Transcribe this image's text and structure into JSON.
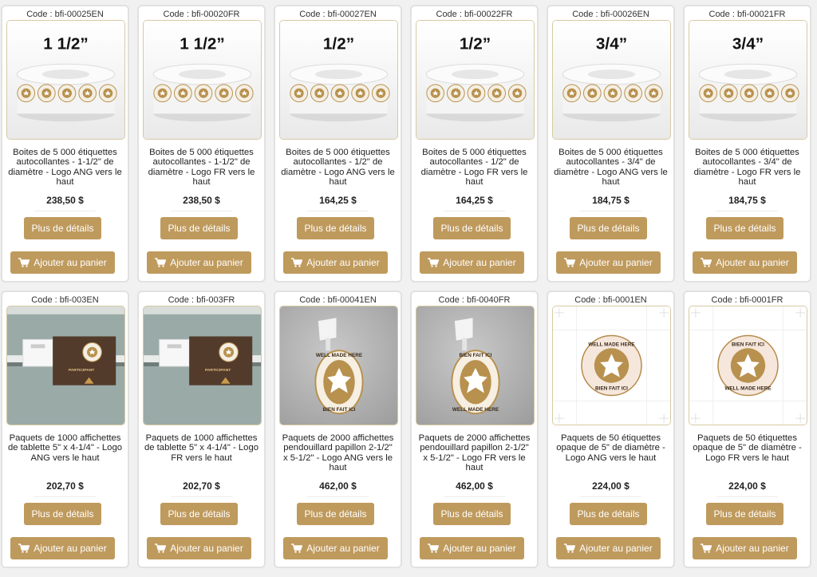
{
  "colors": {
    "accent": "#bf9a5d",
    "border": "#e1e1e1",
    "image_border": "#d8c9a3"
  },
  "products": [
    {
      "code": "Code : bfi-00025EN",
      "title": "Boites de 5 000 étiquettes autocollantes - 1-1/2\" de diamètre - Logo ANG vers le haut",
      "price": "238,50 $",
      "details_label": "Plus de détails",
      "cart_label": "Ajouter au panier",
      "image": {
        "kind": "roll",
        "size_label": "1 1/2”",
        "seal_text": "WELL MADE HERE"
      }
    },
    {
      "code": "Code : bfi-00020FR",
      "title": "Boites de 5 000 étiquettes autocollantes - 1-1/2\" de diamètre - Logo FR vers le haut",
      "price": "238,50 $",
      "details_label": "Plus de détails",
      "cart_label": "Ajouter au panier",
      "image": {
        "kind": "roll",
        "size_label": "1 1/2”",
        "seal_text": "BIEN FAIT ICI"
      }
    },
    {
      "code": "Code : bfi-00027EN",
      "title": "Boites de 5 000 étiquettes autocollantes - 1/2\" de diamètre - Logo ANG vers le haut",
      "price": "164,25 $",
      "details_label": "Plus de détails",
      "cart_label": "Ajouter au panier",
      "image": {
        "kind": "roll",
        "size_label": "1/2”",
        "seal_text": "WELL MADE HERE"
      }
    },
    {
      "code": "Code : bfi-00022FR",
      "title": "Boites de 5 000 étiquettes autocollantes - 1/2\" de diamètre - Logo FR vers le haut",
      "price": "164,25 $",
      "details_label": "Plus de détails",
      "cart_label": "Ajouter au panier",
      "image": {
        "kind": "roll",
        "size_label": "1/2”",
        "seal_text": "BIEN FAIT ICI"
      }
    },
    {
      "code": "Code : bfi-00026EN",
      "title": "Boites de 5 000 étiquettes autocollantes - 3/4\" de diamètre - Logo ANG vers le haut",
      "price": "184,75 $",
      "details_label": "Plus de détails",
      "cart_label": "Ajouter au panier",
      "image": {
        "kind": "roll",
        "size_label": "3/4”",
        "seal_text": "WELL MADE HERE"
      }
    },
    {
      "code": "Code : bfi-00021FR",
      "title": "Boites de 5 000 étiquettes autocollantes - 3/4\" de diamètre - Logo FR vers le haut",
      "price": "184,75 $",
      "details_label": "Plus de détails",
      "cart_label": "Ajouter au panier",
      "image": {
        "kind": "roll",
        "size_label": "3/4”",
        "seal_text": "BIEN FAIT ICI"
      }
    },
    {
      "code": "Code : bfi-003EN",
      "title": "Paquets de 1000 affichettes de tablette 5\" x 4-1/4\" - Logo ANG vers le haut",
      "price": "202,70 $",
      "details_label": "Plus de détails",
      "cart_label": "Ajouter au panier",
      "image": {
        "kind": "shelf",
        "shelf_text": "PARTICIPANT Well Made Here program"
      }
    },
    {
      "code": "Code : bfi-003FR",
      "title": "Paquets de 1000 affichettes de tablette 5\" x 4-1/4\" - Logo FR vers le haut",
      "price": "202,70 $",
      "details_label": "Plus de détails",
      "cart_label": "Ajouter au panier",
      "image": {
        "kind": "shelf",
        "shelf_text": "PARTICIPANT au programme Bien fait ici"
      }
    },
    {
      "code": "Code : bfi-00041EN",
      "title": "Paquets de 2000 affichettes pendouillard papillon 2-1/2\" x 5-1/2\" - Logo ANG vers le haut",
      "price": "462,00 $",
      "details_label": "Plus de détails",
      "cart_label": "Ajouter au panier",
      "image": {
        "kind": "wobbler",
        "top_text": "WELL MADE HERE",
        "bottom_text": "BIEN FAIT ICI"
      }
    },
    {
      "code": "Code : bfi-0040FR",
      "title": "Paquets de 2000 affichettes pendouillard papillon 2-1/2\" x 5-1/2\" - Logo FR vers le haut",
      "price": "462,00 $",
      "details_label": "Plus de détails",
      "cart_label": "Ajouter au panier",
      "image": {
        "kind": "wobbler",
        "top_text": "BIEN FAIT ICI",
        "bottom_text": "WELL MADE HERE"
      }
    },
    {
      "code": "Code : bfi-0001EN",
      "title": "Paquets de 50 étiquettes opaque de 5\" de diamètre - Logo ANG vers le haut",
      "price": "224,00 $",
      "details_label": "Plus de détails",
      "cart_label": "Ajouter au panier",
      "image": {
        "kind": "sticker",
        "top_text": "WELL MADE HERE",
        "bottom_text": "BIEN FAIT ICI"
      }
    },
    {
      "code": "Code : bfi-0001FR",
      "title": "Paquets de 50 étiquettes opaque de 5\" de diamètre - Logo FR vers le haut",
      "price": "224,00 $",
      "details_label": "Plus de détails",
      "cart_label": "Ajouter au panier",
      "image": {
        "kind": "sticker",
        "top_text": "BIEN FAIT ICI",
        "bottom_text": "WELL MADE HERE"
      }
    }
  ]
}
